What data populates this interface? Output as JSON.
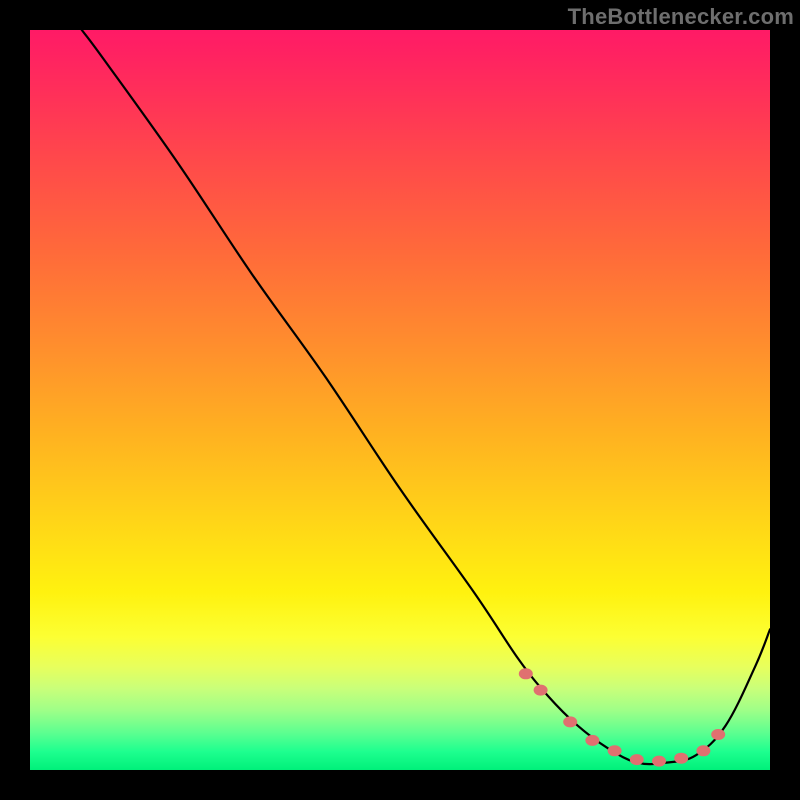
{
  "watermark": "TheBottlenecker.com",
  "chart_data": {
    "type": "line",
    "title": "",
    "xlabel": "",
    "ylabel": "",
    "xlim": [
      0,
      100
    ],
    "ylim": [
      0,
      100
    ],
    "grid": false,
    "legend": false,
    "series": [
      {
        "name": "bottleneck-curve",
        "x": [
          7,
          10,
          20,
          30,
          40,
          50,
          60,
          66,
          70,
          74,
          78,
          82,
          86,
          90,
          94,
          98,
          100
        ],
        "values": [
          100,
          96,
          82,
          67,
          53,
          38,
          24,
          15,
          10,
          6,
          3,
          1,
          1,
          2,
          6,
          14,
          19
        ]
      }
    ],
    "markers": {
      "name": "highlight-points",
      "x": [
        67,
        69,
        73,
        76,
        79,
        82,
        85,
        88,
        91,
        93
      ],
      "values": [
        13.0,
        10.8,
        6.5,
        4.0,
        2.6,
        1.4,
        1.2,
        1.6,
        2.6,
        4.8
      ],
      "color": "#e07070"
    },
    "background": {
      "type": "vertical-gradient",
      "stops": [
        {
          "pos": 0,
          "color": "#ff1a66"
        },
        {
          "pos": 18,
          "color": "#ff4a4a"
        },
        {
          "pos": 42,
          "color": "#ff8c2e"
        },
        {
          "pos": 66,
          "color": "#ffd418"
        },
        {
          "pos": 82,
          "color": "#fcff33"
        },
        {
          "pos": 95,
          "color": "#5cff90"
        },
        {
          "pos": 100,
          "color": "#00f07a"
        }
      ]
    }
  }
}
